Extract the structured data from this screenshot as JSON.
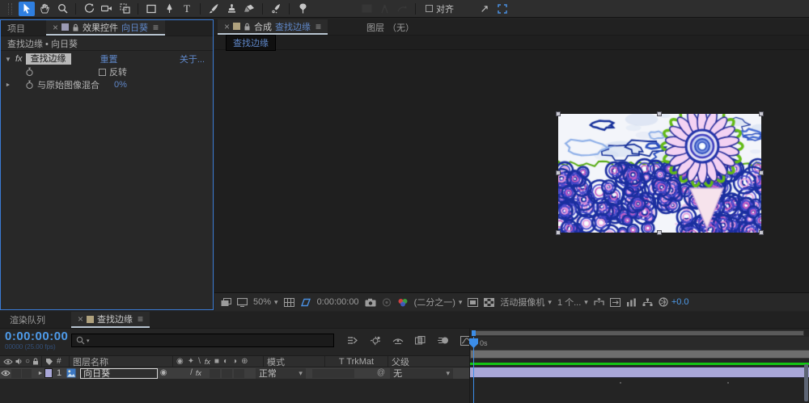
{
  "glyphs": {
    "close": "×",
    "menu": "≡",
    "chevron": "▾",
    "tri_down": "▼",
    "tri_right": "►",
    "fx": "fx",
    "slash": "/",
    "at": "@",
    "quality": "◉",
    "star": "✦",
    "backslash": "\\",
    "square": "■",
    "half_left": "◐",
    "half_right": "◑",
    "circle_plus": "⊕",
    "solo": "○",
    "hash": "#",
    "aperture": "◉",
    "arrow_ne": "↗"
  },
  "toolbar": {
    "align_label": "对齐"
  },
  "effect_panel": {
    "tab_project": "项目",
    "tab_title": "效果控件",
    "tab_target": "向日葵",
    "breadcrumb": "查找边缘 • 向日葵",
    "effect_name": "查找边缘",
    "reset_label": "重置",
    "about_label": "关于...",
    "invert_label": "反转",
    "blend_label": "与原始图像混合",
    "blend_value": "0%"
  },
  "viewer": {
    "tab_comp_label": "合成",
    "tab_comp_name": "查找边缘",
    "tab_layer_label": "图层",
    "tab_layer_value": "（无）",
    "breadcrumb": "查找边缘",
    "zoom_level": "50%",
    "timecode": "0:00:00:00",
    "resolution": "(二分之一)",
    "camera_view": "活动摄像机",
    "view_count": "1 个...",
    "exposure": "+0.0"
  },
  "timeline": {
    "tab_render_queue": "渲染队列",
    "tab_comp": "查找边缘",
    "timecode": "0:00:00:00",
    "frame_info": "00000 (25.00 fps)",
    "col_layer_name": "图层名称",
    "col_mode": "模式",
    "col_trkmat": "T TrkMat",
    "col_parent": "父级",
    "layer_number": "1",
    "layer_name": "向日葵",
    "layer_mode": "正常",
    "layer_parent": "无",
    "ruler_label": "0s"
  },
  "colors": {
    "accent_blue": "#3c8de8",
    "link_blue": "#5f87c8",
    "timecode_blue": "#4e9bea",
    "label_lavender": "#a9a7d8",
    "render_green": "#14c414"
  }
}
